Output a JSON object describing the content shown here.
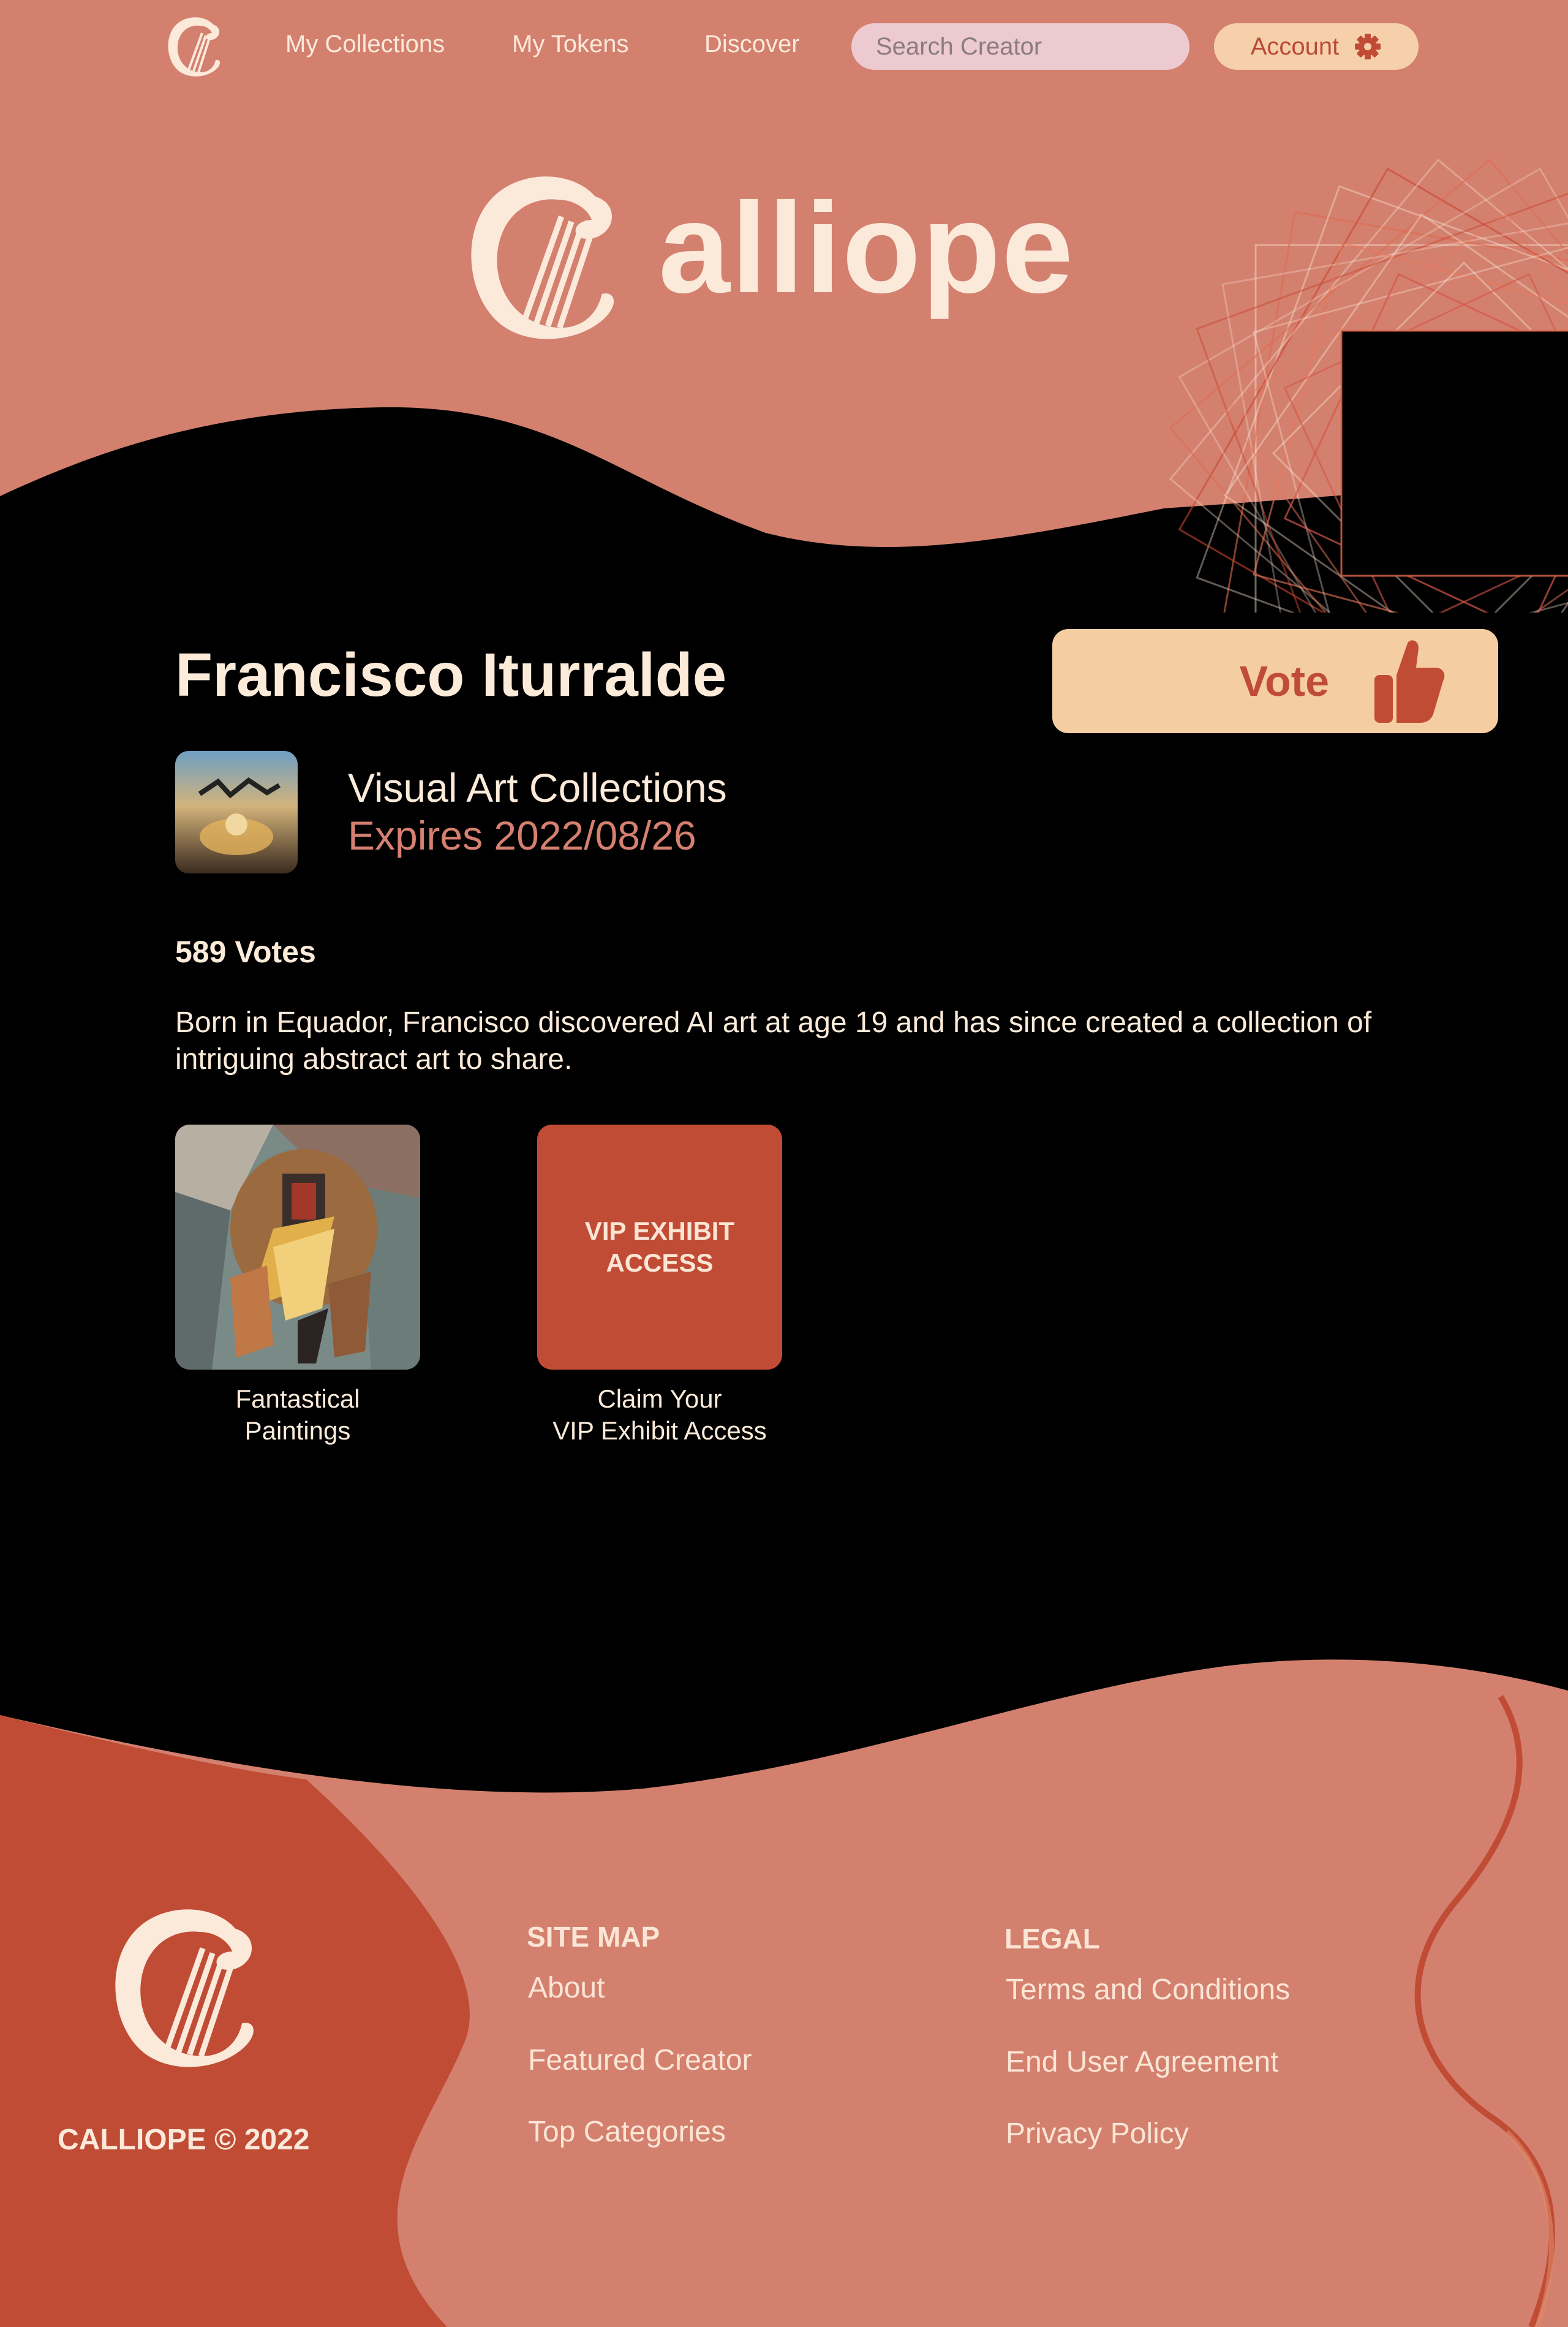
{
  "nav": {
    "links": [
      "My Collections",
      "My Tokens",
      "Discover"
    ],
    "search_placeholder": "Search Creator",
    "account_label": "Account"
  },
  "hero": {
    "brand_text": "alliope"
  },
  "creator": {
    "name": "Francisco Iturralde",
    "vote_label": "Vote",
    "collection_title": "Visual Art Collections",
    "expiry": "Expires 2022/08/26",
    "votes": "589 Votes",
    "bio": "Born in Equador, Francisco discovered AI art at age 19 and has since created a collection of intriguing abstract art to share."
  },
  "cards": [
    {
      "caption_line1": "Fantastical",
      "caption_line2": "Paintings"
    },
    {
      "tile_text": "VIP EXHIBIT ACCESS",
      "caption_line1": "Claim Your",
      "caption_line2": "VIP Exhibit Access"
    }
  ],
  "footer": {
    "copyright": "CALLIOPE © 2022",
    "sitemap": {
      "heading": "SITE MAP",
      "links": [
        "About",
        "Featured Creator",
        "Top Categories"
      ]
    },
    "legal": {
      "heading": "LEGAL",
      "links": [
        "Terms and Conditions",
        "End User Agreement",
        "Privacy Policy"
      ]
    }
  },
  "colors": {
    "salmon": "#d3806f",
    "rust": "#c14c35",
    "cream": "#fbe9da",
    "peach": "#f5cda3",
    "black": "#000000"
  }
}
